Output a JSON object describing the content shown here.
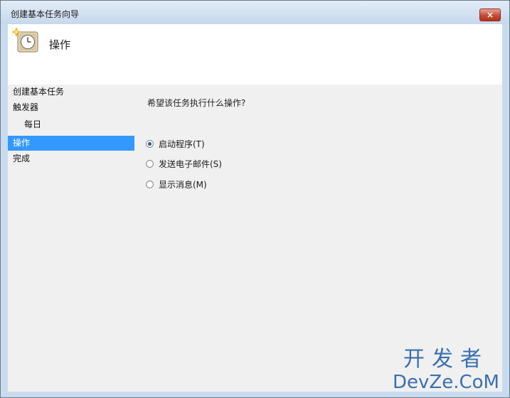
{
  "window": {
    "title": "创建基本任务向导",
    "close_symbol": "×"
  },
  "header": {
    "icon": "clock-icon",
    "title": "操作"
  },
  "nav": {
    "items": [
      {
        "label": "创建基本任务",
        "indent": false,
        "selected": false
      },
      {
        "label": "触发器",
        "indent": false,
        "selected": false
      },
      {
        "label": "每日",
        "indent": true,
        "selected": false
      },
      {
        "label": "操作",
        "indent": false,
        "selected": true
      },
      {
        "label": "完成",
        "indent": false,
        "selected": false
      }
    ]
  },
  "main": {
    "question": "希望该任务执行什么操作?",
    "options": [
      {
        "label": "启动程序(T)",
        "checked": true
      },
      {
        "label": "发送电子邮件(S)",
        "checked": false
      },
      {
        "label": "显示消息(M)",
        "checked": false
      }
    ]
  },
  "watermark": {
    "cn": "开发者",
    "en": "DevZe.CoM"
  },
  "colors": {
    "selected_bg": "#3399ff",
    "close_button": "#c74a35",
    "watermark": "#3a6fb0"
  }
}
